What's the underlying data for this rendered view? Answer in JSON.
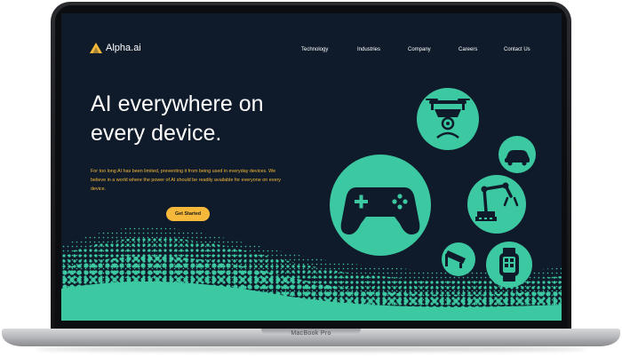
{
  "brand": {
    "name": "Alpha.ai",
    "logo_color": "#f5b83a"
  },
  "nav": {
    "items": [
      "Technology",
      "Industries",
      "Company",
      "Careers",
      "Contact Us"
    ]
  },
  "hero": {
    "title_line1": "AI everywhere on",
    "title_line2": "every device.",
    "description": "For too long AI has been limited, preventing it from being used in everyday devices. We believe in a world where the power of AI should be readily available for everyone on every device.",
    "cta_label": "Get Started"
  },
  "device": {
    "model": "MacBook Pro"
  },
  "colors": {
    "background": "#0f1b2a",
    "accent": "#3cc8a0",
    "highlight": "#f5b83a",
    "text": "#ffffff"
  },
  "icons": [
    "drone-icon",
    "car-icon",
    "gamepad-icon",
    "robot-arm-icon",
    "security-camera-icon",
    "smartwatch-icon"
  ]
}
